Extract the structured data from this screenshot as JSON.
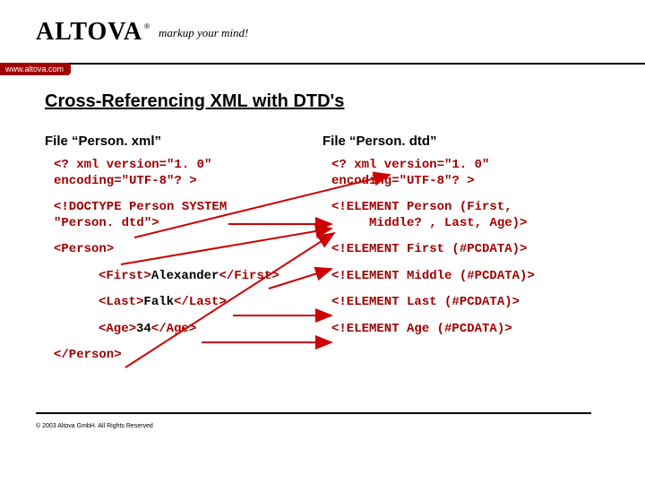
{
  "brand": {
    "name": "ALTOVA",
    "reg": "®",
    "tagline": "markup your mind!",
    "tab": "www.altova.com"
  },
  "title": "Cross-Referencing XML with DTD's",
  "left": {
    "file": "File “Person. xml”",
    "r0a": "<? xml version=\"1. 0\"",
    "r0b": "encoding=\"UTF-8\"? >",
    "r1a": "<!DOCTYPE Person SYSTEM",
    "r1b": "\"Person. dtd\">",
    "r2": "<Person>",
    "r3_open": "<First>",
    "r3_txt": "Alexander",
    "r3_close": "</First>",
    "r4_open": "<Last>",
    "r4_txt": "Falk",
    "r4_close": "</Last>",
    "r5_open": "<Age>",
    "r5_txt": "34",
    "r5_close": "</Age>",
    "r6": "</Person>"
  },
  "right": {
    "file": "File “Person. dtd”",
    "r0a": "<? xml version=\"1. 0\"",
    "r0b": "encoding=\"UTF-8\"? >",
    "r1a": "<!ELEMENT Person (First,",
    "r1b": "Middle? , Last, Age)>",
    "r2": "<!ELEMENT First (#PCDATA)>",
    "r3": "<!ELEMENT Middle (#PCDATA)>",
    "r4": "<!ELEMENT Last (#PCDATA)>",
    "r5": "<!ELEMENT Age (#PCDATA)>"
  },
  "footer": "© 2003 Altova GmbH. All Rights Reserved"
}
